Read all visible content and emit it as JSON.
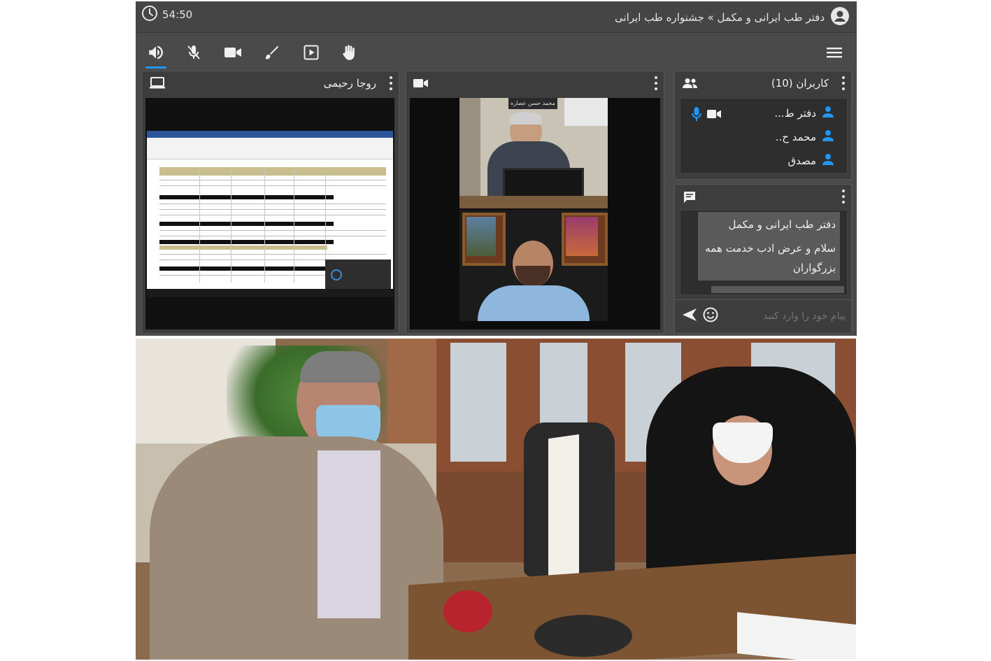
{
  "app": {
    "timer": "54:50",
    "title": "دفتر طب ایرانی و مکمل » جشنواره طب ایرانی",
    "accent_color": "#2196f3"
  },
  "toolbar": {
    "items": [
      {
        "name": "speaker-icon",
        "active": true
      },
      {
        "name": "mic-off-icon"
      },
      {
        "name": "camera-icon"
      },
      {
        "name": "brush-icon"
      },
      {
        "name": "presentation-icon"
      },
      {
        "name": "raise-hand-icon"
      }
    ],
    "menu_icon": "hamburger-menu-icon"
  },
  "screenshare_panel": {
    "title": "روجا رحیمی",
    "icon": "laptop-icon"
  },
  "video_panel": {
    "icon": "video-camera-icon",
    "caption": "محمد حسن عصاره"
  },
  "users_panel": {
    "title": "کاربران (10)",
    "icon": "users-icon",
    "users": [
      {
        "name": "دفتر ط...",
        "mic": true,
        "camera": true
      },
      {
        "name": "محمد ح..",
        "mic": false,
        "camera": false
      },
      {
        "name": "مصدق",
        "mic": false,
        "camera": false
      }
    ]
  },
  "chat_panel": {
    "icon": "chat-icon",
    "sender": "دفتر طب ایرانی و مکمل",
    "message_line1": "سلام و عرض ادب خدمت همه",
    "message_line2": "بزرگواران",
    "input_placeholder": "پیام خود را وارد کنید"
  }
}
